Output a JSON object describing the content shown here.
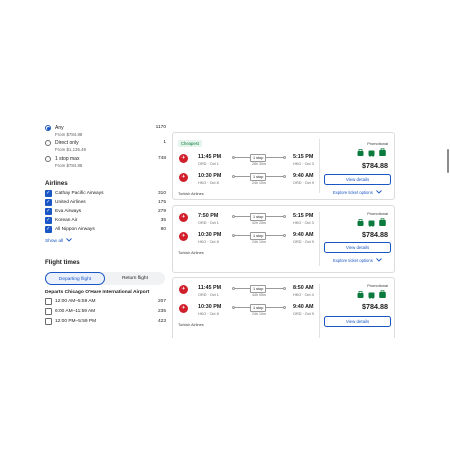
{
  "colors": {
    "accent": "#1a56c4",
    "brand_airline": "#d01e2b",
    "cheapest_green": "#0a7a3d"
  },
  "stops_filter": [
    {
      "label": "Any",
      "sub": "From $784.88",
      "count": "1170",
      "selected": true
    },
    {
      "label": "Direct only",
      "sub": "From $1,135.49",
      "count": "1",
      "selected": false
    },
    {
      "label": "1 stop max",
      "sub": "From $784.88",
      "count": "748",
      "selected": false
    }
  ],
  "airlines": {
    "title": "Airlines",
    "items": [
      {
        "label": "Cathay Pacific Airways",
        "count": "310",
        "checked": true
      },
      {
        "label": "United Airlines",
        "count": "175",
        "checked": true
      },
      {
        "label": "Eva Airways",
        "count": "279",
        "checked": true
      },
      {
        "label": "Korean Air",
        "count": "35",
        "checked": true
      },
      {
        "label": "All Nippon Airways",
        "count": "80",
        "checked": true
      }
    ],
    "show_all": "Show all"
  },
  "flight_times": {
    "title": "Flight times",
    "tabs": [
      "Departing flight",
      "Return flight"
    ],
    "departs_title": "Departs Chicago O'Hare International Airport",
    "slots": [
      {
        "label": "12:00 AM–5:59 AM",
        "count": "207"
      },
      {
        "label": "6:00 AM–11:59 AM",
        "count": "235"
      },
      {
        "label": "12:00 PM–5:59 PM",
        "count": "423"
      }
    ]
  },
  "results": [
    {
      "badge": "Cheapest",
      "legs": [
        {
          "dep_time": "11:45 PM",
          "dep_sub": "ORD · Oct 1",
          "stops": "1 stop",
          "duration": "28h 30m",
          "arr_time": "5:15 PM",
          "arr_sub": "HKG · Oct 3"
        },
        {
          "dep_time": "10:30 PM",
          "dep_sub": "HKG · Oct 8",
          "stops": "1 stop",
          "duration": "24h 10m",
          "arr_time": "9:40 AM",
          "arr_sub": "ORD · Oct 9"
        }
      ],
      "airline": "Turkish Airlines",
      "promo": "Promotional",
      "price": "$784.88",
      "cta": "View details",
      "explore": "Explore ticket options"
    },
    {
      "badge": "",
      "legs": [
        {
          "dep_time": "7:50 PM",
          "dep_sub": "ORD · Oct 1",
          "stops": "1 stop",
          "duration": "32h 25m",
          "arr_time": "5:15 PM",
          "arr_sub": "HKG · Oct 3"
        },
        {
          "dep_time": "10:30 PM",
          "dep_sub": "HKG · Oct 8",
          "stops": "1 stop",
          "duration": "24h 10m",
          "arr_time": "9:40 AM",
          "arr_sub": "ORD · Oct 9"
        }
      ],
      "airline": "Turkish Airlines",
      "promo": "Promotional",
      "price": "$784.88",
      "cta": "View details",
      "explore": "Explore ticket options"
    },
    {
      "badge": "",
      "legs": [
        {
          "dep_time": "11:45 PM",
          "dep_sub": "ORD · Oct 1",
          "stops": "1 stop",
          "duration": "44h 05m",
          "arr_time": "8:50 AM",
          "arr_sub": "HKG · Oct 4"
        },
        {
          "dep_time": "10:30 PM",
          "dep_sub": "HKG · Oct 8",
          "stops": "1 stop",
          "duration": "24h 10m",
          "arr_time": "9:40 AM",
          "arr_sub": "ORD · Oct 9"
        }
      ],
      "airline": "Turkish Airlines",
      "promo": "Promotional",
      "price": "$784.88",
      "cta": "View details",
      "explore": ""
    }
  ]
}
